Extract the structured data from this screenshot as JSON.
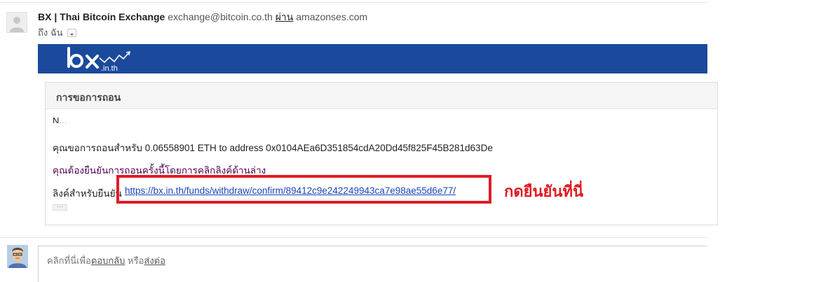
{
  "header": {
    "sender_name": "BX | Thai Bitcoin Exchange",
    "sender_email": "exchange@bitcoin.co.th",
    "via_label": "ผ่าน",
    "via_domain": "amazonses.com",
    "recipient_label": "ถึง ฉัน"
  },
  "email": {
    "brand_color": "#1b4a9c",
    "logo_text": "bx.in.th",
    "section_title": "การขอการถอน",
    "greeting": "N...",
    "withdraw_text": "คุณขอการถอนสำหรับ 0.06558901 ETH to address 0x0104AEa6D351854cdA20Dd45f825F45B281d63De",
    "confirm_instruction": "คุณต้องยืนยันการถอนครั้งนี้โดยการคลิกลิงค์ด้านล่าง",
    "link_label": "ลิงค์สำหรับยืนยัน",
    "confirm_link": "https://bx.in.th/funds/withdraw/confirm/89412c9e242249943ca7e98ae55d6e77/",
    "ellipsis": "···"
  },
  "annotation": {
    "text": "กดยืนยันที่นี่",
    "color": "#e01b24"
  },
  "reply": {
    "prompt_prefix": "คลิกที่นี่เพื่อ",
    "reply_label": "ตอบกลับ",
    "or_label": " หรือ",
    "forward_label": "ส่งต่อ"
  }
}
